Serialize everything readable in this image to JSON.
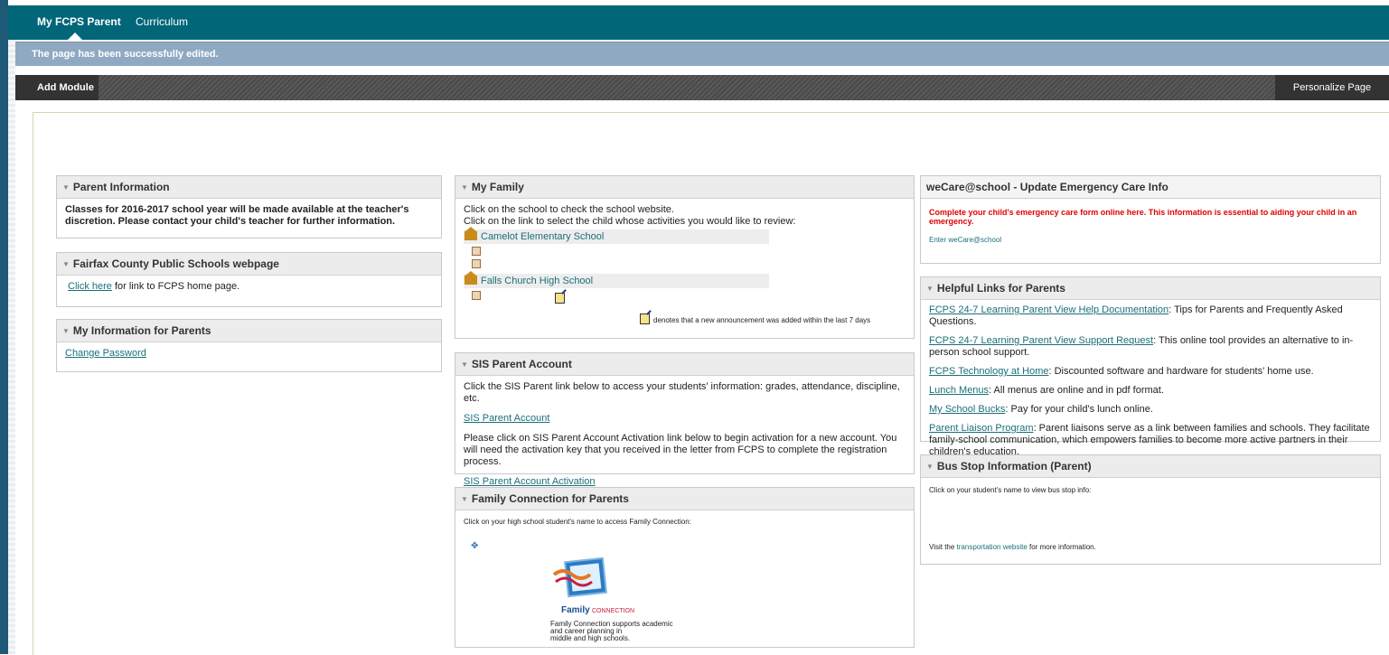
{
  "tabs": {
    "active": "My FCPS Parent",
    "curriculum": "Curriculum"
  },
  "status": "The page has been successfully edited.",
  "actions": {
    "add_module": "Add Module",
    "personalize": "Personalize Page"
  },
  "parent_info": {
    "title": "Parent Information",
    "text": "Classes for 2016-2017 school year will be made available at the teacher's discretion. Please contact your child's teacher for further information."
  },
  "fcps_web": {
    "title": "Fairfax County Public Schools webpage",
    "link": "Click here",
    "text": " for link to FCPS home page."
  },
  "my_info": {
    "title": "My Information for Parents",
    "link": "Change Password"
  },
  "family": {
    "title": "My Family",
    "line1": "Click on the school to check the school website.",
    "line2": "Click on the link to select the child whose activities you would like to review:",
    "school1": "Camelot Elementary School",
    "school2": "Falls Church High School",
    "legend": "denotes that a new announcement was added within the last 7 days"
  },
  "sis": {
    "title": "SIS Parent Account",
    "intro": "Click the SIS Parent link below to access your students' information: grades, attendance, discipline, etc.",
    "link1": "SIS Parent Account",
    "para": "Please click on SIS Parent Account Activation link below to begin activation for a new account. You will need the activation key that you received in the letter from FCPS to complete the registration process.",
    "link2": "SIS Parent Account Activation"
  },
  "fc": {
    "title": "Family Connection for Parents",
    "intro": "Click on your high school student's name to access Family Connection:",
    "logo_family": "Family",
    "logo_conn": "CONNECTION",
    "caption1": "Family Connection supports academic",
    "caption2": "and career planning in",
    "caption3": "middle and high schools."
  },
  "wecare": {
    "title": "weCare@school - Update Emergency Care Info",
    "warn": "Complete your child's emergency care form online here. This information is essential to aiding your child in an emergency.",
    "link": "Enter weCare@school"
  },
  "helpful": {
    "title": "Helpful Links for Parents",
    "items": [
      {
        "link": "FCPS 24-7 Learning Parent View Help Documentation",
        "text": ": Tips for Parents and Frequently Asked Questions."
      },
      {
        "link": "FCPS 24-7 Learning Parent View Support Request",
        "text": ": This online tool provides an alternative to in-person school support."
      },
      {
        "link": "FCPS Technology at Home",
        "text": ": Discounted software and hardware for students' home use."
      },
      {
        "link": "Lunch Menus",
        "text": ": All menus are online and in pdf format."
      },
      {
        "link": "My School Bucks",
        "text": ": Pay for your child's lunch online."
      },
      {
        "link": "Parent Liaison Program",
        "text": ": Parent liaisons serve as a link between families and schools. They facilitate family-school communication, which empowers families to become more active partners in their children's education."
      }
    ]
  },
  "bus": {
    "title": "Bus Stop Information (Parent)",
    "intro": "Click on your student's name to view bus stop info:",
    "pre": "Visit the ",
    "link": "transportation website",
    "post": " for more information."
  },
  "colors": {
    "topbar": "#006678",
    "statusbar": "#90a9c3",
    "link": "#1a6f7a",
    "warn": "#e00000"
  }
}
